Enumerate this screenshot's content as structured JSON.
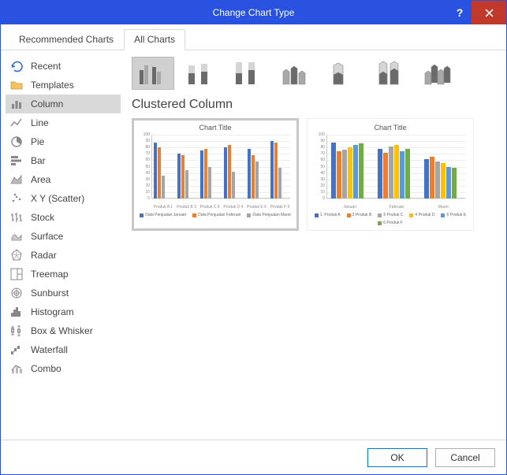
{
  "window": {
    "title": "Change Chart Type"
  },
  "tabs": {
    "recommended": "Recommended Charts",
    "all": "All Charts",
    "active": "all"
  },
  "sidebar": {
    "items": [
      {
        "label": "Recent"
      },
      {
        "label": "Templates"
      },
      {
        "label": "Column"
      },
      {
        "label": "Line"
      },
      {
        "label": "Pie"
      },
      {
        "label": "Bar"
      },
      {
        "label": "Area"
      },
      {
        "label": "X Y (Scatter)"
      },
      {
        "label": "Stock"
      },
      {
        "label": "Surface"
      },
      {
        "label": "Radar"
      },
      {
        "label": "Treemap"
      },
      {
        "label": "Sunburst"
      },
      {
        "label": "Histogram"
      },
      {
        "label": "Box & Whisker"
      },
      {
        "label": "Waterfall"
      },
      {
        "label": "Combo"
      }
    ],
    "selected_index": 2
  },
  "subtype": {
    "title": "Clustered Column",
    "types": [
      "clustered-column",
      "stacked-column",
      "100-stacked-column",
      "3d-clustered-column",
      "3d-stacked-column",
      "3d-100-stacked-column",
      "3d-column"
    ],
    "selected_index": 0
  },
  "previews": {
    "selected_index": 0,
    "charts": [
      {
        "title": "Chart Title",
        "ymax": 100,
        "yticks": [
          0,
          10,
          20,
          30,
          40,
          50,
          60,
          70,
          80,
          90,
          100
        ],
        "categories": [
          "Produk A",
          "Produk B",
          "Produk C",
          "Produk D",
          "Produk E",
          "Produk F"
        ],
        "category_sub": [
          "1",
          "3",
          "6",
          "4",
          "6",
          "6"
        ],
        "series": [
          {
            "name": "Data Penjualan Januari",
            "color": "#4472c4",
            "values": [
              88,
              70,
              75,
              80,
              78,
              90
            ]
          },
          {
            "name": "Data Penjualan Februari",
            "color": "#ed7d31",
            "values": [
              80,
              68,
              78,
              84,
              68,
              88
            ]
          },
          {
            "name": "Data Penjualan Maret",
            "color": "#a5a5a5",
            "values": [
              36,
              45,
              50,
              42,
              58,
              48
            ]
          }
        ]
      },
      {
        "title": "Chart Title",
        "ymax": 100,
        "yticks": [
          0,
          10,
          20,
          30,
          40,
          50,
          60,
          70,
          80,
          90,
          100
        ],
        "categories": [
          "Januari",
          "Februari",
          "Maret"
        ],
        "series": [
          {
            "name": "1. Produk A",
            "color": "#4472c4",
            "values": [
              88,
              78,
              62
            ]
          },
          {
            "name": "3 Produk B",
            "color": "#ed7d31",
            "values": [
              74,
              72,
              66
            ]
          },
          {
            "name": "6 Produk C",
            "color": "#a5a5a5",
            "values": [
              76,
              82,
              58
            ]
          },
          {
            "name": "4 Produk D",
            "color": "#ffc000",
            "values": [
              80,
              84,
              56
            ]
          },
          {
            "name": "6 Produk E",
            "color": "#5b9bd5",
            "values": [
              84,
              74,
              50
            ]
          },
          {
            "name": "6 Produk F",
            "color": "#70ad47",
            "values": [
              86,
              78,
              48
            ]
          }
        ]
      }
    ]
  },
  "footer": {
    "ok": "OK",
    "cancel": "Cancel"
  },
  "chart_data": [
    {
      "type": "bar",
      "title": "Chart Title",
      "categories": [
        "Produk A",
        "Produk B",
        "Produk C",
        "Produk D",
        "Produk E",
        "Produk F"
      ],
      "series": [
        {
          "name": "Data Penjualan Januari",
          "values": [
            88,
            70,
            75,
            80,
            78,
            90
          ]
        },
        {
          "name": "Data Penjualan Februari",
          "values": [
            80,
            68,
            78,
            84,
            68,
            88
          ]
        },
        {
          "name": "Data Penjualan Maret",
          "values": [
            36,
            45,
            50,
            42,
            58,
            48
          ]
        }
      ],
      "ylim": [
        0,
        100
      ],
      "xlabel": "",
      "ylabel": ""
    },
    {
      "type": "bar",
      "title": "Chart Title",
      "categories": [
        "Januari",
        "Februari",
        "Maret"
      ],
      "series": [
        {
          "name": "Produk A",
          "values": [
            88,
            78,
            62
          ]
        },
        {
          "name": "Produk B",
          "values": [
            74,
            72,
            66
          ]
        },
        {
          "name": "Produk C",
          "values": [
            76,
            82,
            58
          ]
        },
        {
          "name": "Produk D",
          "values": [
            80,
            84,
            56
          ]
        },
        {
          "name": "Produk E",
          "values": [
            84,
            74,
            50
          ]
        },
        {
          "name": "Produk F",
          "values": [
            86,
            78,
            48
          ]
        }
      ],
      "ylim": [
        0,
        100
      ],
      "xlabel": "",
      "ylabel": ""
    }
  ]
}
